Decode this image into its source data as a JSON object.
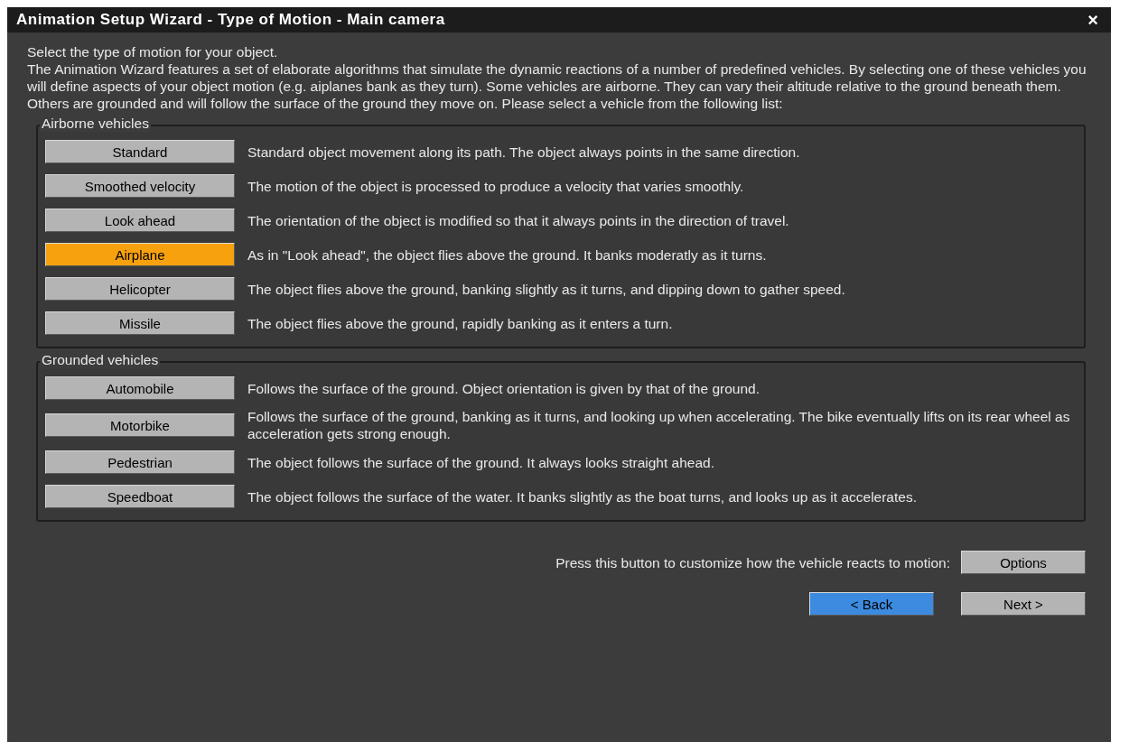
{
  "window": {
    "title": "Animation Setup Wizard - Type of Motion - Main camera",
    "close": "×"
  },
  "intro": [
    "Select the type of motion for your object.",
    "The Animation Wizard features a set of elaborate algorithms that simulate the dynamic reactions of a number of predefined vehicles. By selecting one of these vehicles you will define aspects of your object motion (e.g. aiplanes bank as they turn). Some vehicles are airborne. They can vary their altitude relative to the ground beneath them. Others are grounded and will follow the surface of the ground they move on. Please select a vehicle from the following list:"
  ],
  "groups": [
    {
      "title": "Airborne vehicles",
      "vehicles": [
        {
          "label": "Standard",
          "description": "Standard object movement along its path. The object always points in the same direction.",
          "selected": false
        },
        {
          "label": "Smoothed velocity",
          "description": "The motion of the object is processed to produce a velocity that varies smoothly.",
          "selected": false
        },
        {
          "label": "Look ahead",
          "description": "The orientation of the object is modified so that it always points in the direction of travel.",
          "selected": false
        },
        {
          "label": "Airplane",
          "description": "As in \"Look ahead\", the object flies above the ground. It banks moderatly as it turns.",
          "selected": true
        },
        {
          "label": "Helicopter",
          "description": "The object flies above the ground, banking slightly as it turns, and dipping down to gather speed.",
          "selected": false
        },
        {
          "label": "Missile",
          "description": "The object flies above the ground, rapidly banking as it enters a turn.",
          "selected": false
        }
      ]
    },
    {
      "title": "Grounded vehicles",
      "vehicles": [
        {
          "label": "Automobile",
          "description": "Follows the surface of the ground. Object orientation is given by that of the ground.",
          "selected": false
        },
        {
          "label": "Motorbike",
          "description": "Follows the surface of the ground, banking as it turns, and looking up when accelerating. The bike eventually lifts on its rear wheel as acceleration gets strong enough.",
          "selected": false
        },
        {
          "label": "Pedestrian",
          "description": "The object follows the surface of the ground. It always looks straight ahead.",
          "selected": false
        },
        {
          "label": "Speedboat",
          "description": "The object follows the surface of the water. It banks slightly as the boat turns, and looks up as it accelerates.",
          "selected": false
        }
      ]
    }
  ],
  "options": {
    "prompt": "Press this button to customize how the vehicle reacts to motion:",
    "button": "Options"
  },
  "nav": [
    {
      "label": "< Back",
      "focused": true
    },
    {
      "label": "Next >",
      "focused": false
    }
  ]
}
